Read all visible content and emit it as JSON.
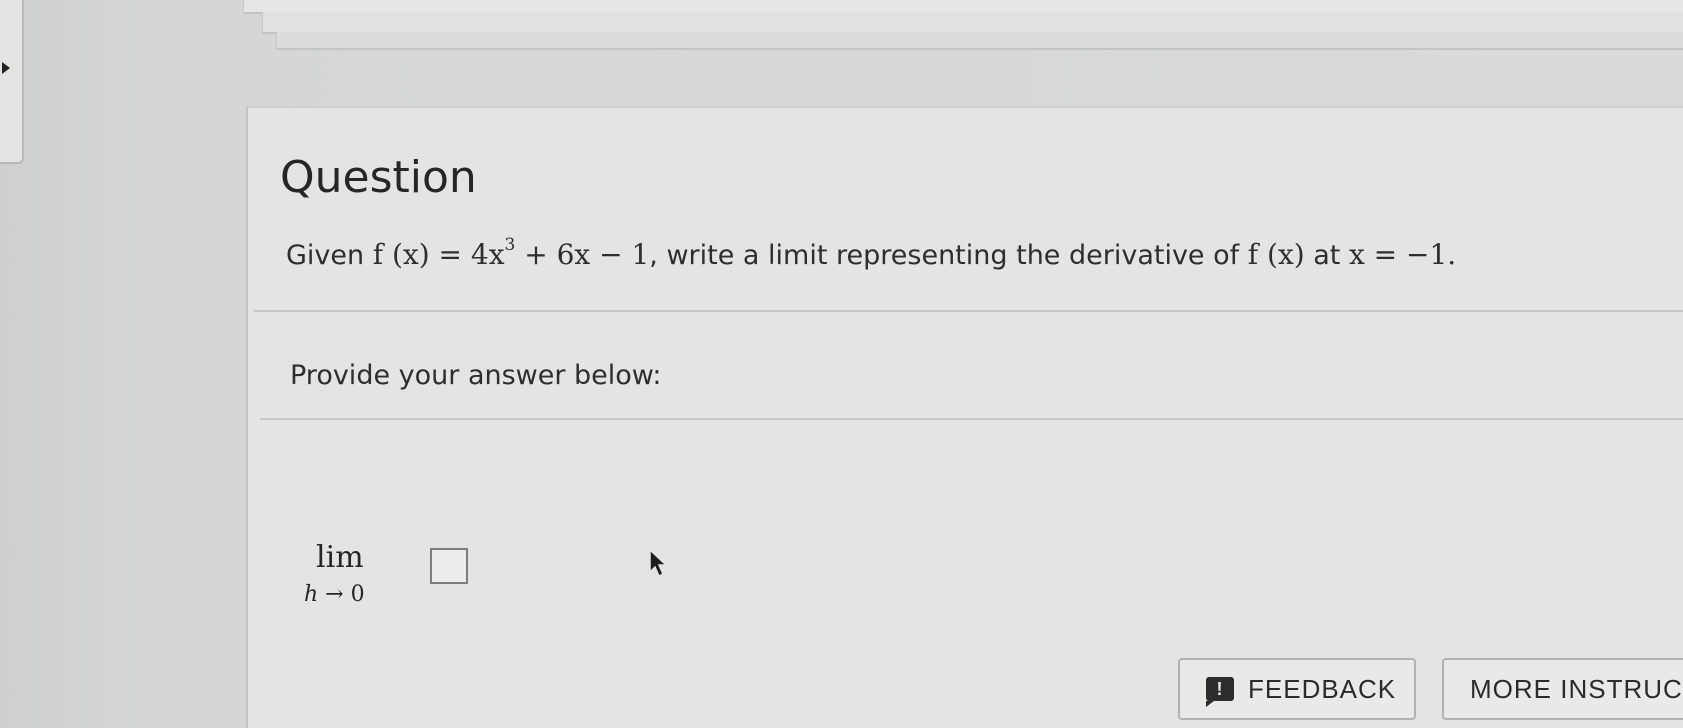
{
  "question": {
    "title": "Question",
    "text_prefix": "Given ",
    "math_function": "f (x) = 4x",
    "math_exponent": "3",
    "math_rest": " + 6x − 1",
    "text_middle": ", write a limit representing the derivative of ",
    "math_fx": "f (x)",
    "text_at": " at ",
    "math_point": "x = −1.",
    "prompt": "Provide your answer below:"
  },
  "answer": {
    "lim_word": "lim",
    "lim_var": "h",
    "lim_arrow": " → 0",
    "value": ""
  },
  "buttons": {
    "feedback_label": "FEEDBACK",
    "feedback_icon_glyph": "!",
    "more_label": "MORE INSTRUC"
  },
  "icons": {
    "feedback": "feedback-exclamation-icon",
    "collapse": "collapse-arrow-icon",
    "cursor": "mouse-pointer-icon"
  }
}
